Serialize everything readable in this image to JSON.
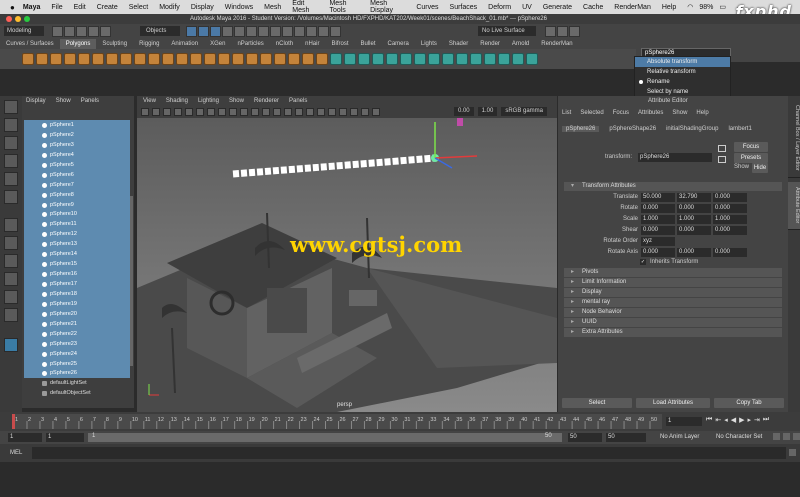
{
  "menubar": {
    "apple": "",
    "app": "Maya",
    "items": [
      "File",
      "Edit",
      "Create",
      "Select",
      "Modify",
      "Display",
      "Windows",
      "Mesh",
      "Edit Mesh",
      "Mesh Tools",
      "Mesh Display",
      "Curves",
      "Surfaces",
      "Deform",
      "UV",
      "Generate",
      "Cache",
      "RenderMan",
      "Help"
    ],
    "battery": "98%"
  },
  "logo": "fxphd",
  "titlebar": {
    "text": "Autodesk Maya 2016 - Student Version: /Volumes/Macintosh HD/FXPHD/KAT202/Week01/scenes/BeachShack_01.mb*  ---  pSphere26"
  },
  "statusline": {
    "menuset": "Modeling",
    "objects": "Objects",
    "live": "No Live Surface"
  },
  "shelf": {
    "tabs": [
      "Curves / Surfaces",
      "Polygons",
      "Sculpting",
      "Rigging",
      "Animation",
      "XGen",
      "nParticles",
      "nCloth",
      "nHair",
      "Bifrost",
      "Bullet",
      "Camera",
      "Lights",
      "Shader",
      "Render",
      "Arnold",
      "RenderMan"
    ],
    "active": "Polygons"
  },
  "rename": {
    "value": "pSphere26"
  },
  "dropdown": {
    "items": [
      "Absolute transform",
      "Relative transform",
      "Rename",
      "Select by name"
    ],
    "highlight": 0
  },
  "outliner": {
    "menu": [
      "Display",
      "Show",
      "Panels"
    ],
    "items": [
      "pSphere1",
      "pSphere2",
      "pSphere3",
      "pSphere4",
      "pSphere5",
      "pSphere6",
      "pSphere7",
      "pSphere8",
      "pSphere9",
      "pSphere10",
      "pSphere11",
      "pSphere12",
      "pSphere13",
      "pSphere14",
      "pSphere15",
      "pSphere16",
      "pSphere17",
      "pSphere18",
      "pSphere19",
      "pSphere20",
      "pSphere21",
      "pSphere22",
      "pSphere23",
      "pSphere24",
      "pSphere25",
      "pSphere26"
    ],
    "sets": [
      "defaultLightSet",
      "defaultObjectSet"
    ]
  },
  "viewport": {
    "menu": [
      "View",
      "Shading",
      "Lighting",
      "Show",
      "Renderer",
      "Panels"
    ],
    "field1": "0.00",
    "field2": "1.00",
    "colorspace": "sRGB gamma",
    "camera": "persp"
  },
  "watermark": "www.cgtsj.com",
  "attr": {
    "title": "Attribute Editor",
    "menu": [
      "List",
      "Selected",
      "Focus",
      "Attributes",
      "Show",
      "Help"
    ],
    "tabs": [
      "pSphere26",
      "pSphereShape26",
      "initialShadingGroup",
      "lambert1"
    ],
    "transform_label": "transform:",
    "transform_value": "pSphere26",
    "buttons": {
      "focus": "Focus",
      "presets": "Presets",
      "show": "Show",
      "hide": "Hide"
    },
    "section": "Transform Attributes",
    "rows": [
      {
        "label": "Translate",
        "values": [
          "50.000",
          "32.790",
          "0.000"
        ]
      },
      {
        "label": "Rotate",
        "values": [
          "0.000",
          "0.000",
          "0.000"
        ]
      },
      {
        "label": "Scale",
        "values": [
          "1.000",
          "1.000",
          "1.000"
        ]
      },
      {
        "label": "Shear",
        "values": [
          "0.000",
          "0.000",
          "0.000"
        ]
      }
    ],
    "rotate_order_label": "Rotate Order",
    "rotate_order": "xyz",
    "rotate_axis_label": "Rotate Axis",
    "rotate_axis": [
      "0.000",
      "0.000",
      "0.000"
    ],
    "inherits": "Inherits Transform",
    "sections": [
      "Pivots",
      "Limit Information",
      "Display",
      "mental ray",
      "Node Behavior",
      "UUID",
      "Extra Attributes"
    ],
    "bottom_buttons": [
      "Select",
      "Load Attributes",
      "Copy Tab"
    ]
  },
  "righttabs": [
    "Channel Box / Layer Editor",
    "Attribute Editor"
  ],
  "timeline": {
    "ticks": [
      "1",
      "2",
      "3",
      "4",
      "5",
      "6",
      "7",
      "8",
      "9",
      "10",
      "11",
      "12",
      "13",
      "14",
      "15",
      "16",
      "17",
      "18",
      "19",
      "20",
      "21",
      "22",
      "23",
      "24",
      "25",
      "26",
      "27",
      "28",
      "29",
      "30",
      "31",
      "32",
      "33",
      "34",
      "35",
      "36",
      "37",
      "38",
      "39",
      "40",
      "41",
      "42",
      "43",
      "44",
      "45",
      "46",
      "47",
      "48",
      "49",
      "50"
    ],
    "current": "1"
  },
  "range": {
    "start": "1",
    "start2": "1",
    "box": "1",
    "end_inner": "50",
    "end": "50",
    "end2": "50",
    "anim_layer": "No Anim Layer",
    "char_set": "No Character Set"
  },
  "cmdline": {
    "label": "MEL"
  }
}
